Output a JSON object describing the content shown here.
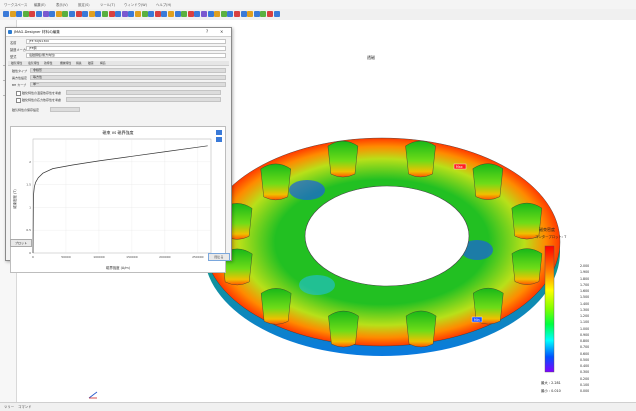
{
  "app": {
    "title_parts": [
      "ワークスペース",
      "編集(E)",
      "表示(V)",
      "設定(S)",
      "ツール(T)",
      "ウィンドウ(W)",
      "ヘルプ(H)"
    ]
  },
  "status": {
    "left_tab": "ツリー",
    "right_tab": "コマンド"
  },
  "dialog": {
    "title": "JMAG-Designer 材料の編集",
    "close": "×",
    "help": "?",
    "fields": [
      {
        "label": "名前",
        "value": "JFE 50JN1300"
      },
      {
        "label": "製造メーカー",
        "value": "JFE鋼"
      },
      {
        "label": "型式",
        "value": "電磁鋼板(無方向性)"
      }
    ],
    "tabs": [
      "磁気特性",
      "電気特性",
      "熱特性",
      "機械特性",
      "損失",
      "磁歪",
      "構造"
    ],
    "rows": [
      {
        "label": "磁性タイプ",
        "value": "非線形"
      },
      {
        "label": "異方性設定",
        "value": "等方性"
      },
      {
        "label": "BH カーブ",
        "value": "単一"
      }
    ],
    "checks": [
      "磁化特性の温度依存性を考慮",
      "磁化特性の応力依存性を考慮"
    ],
    "extra_label": "磁気特性の保存設定",
    "chart_title": "磁束 vs 磁界強度",
    "chart_ylabel": "磁束密度 (T)",
    "chart_xlabel": "磁界強度 (A/m)",
    "bottom_left_btn": "プロット",
    "ok_btn": "閉じる"
  },
  "viewport": {
    "plot_title": "透磁",
    "legend_title_1": "磁束密度",
    "legend_title_2": "コンタープロット: T",
    "legend_values": [
      "2.000",
      "1.900",
      "1.800",
      "1.700",
      "1.600",
      "1.500",
      "1.400",
      "1.300",
      "1.200",
      "1.100",
      "1.000",
      "0.900",
      "0.800",
      "0.700",
      "0.600",
      "0.500",
      "0.400",
      "0.300",
      "0.200",
      "0.100",
      "0.000"
    ],
    "max_label": "最大 : 2.281",
    "min_label": "最小 : 0.010",
    "callout_max": "Max",
    "callout_min": "Min"
  },
  "chart_data": {
    "type": "line",
    "title": "磁束 vs 磁界強度",
    "xlabel": "磁界強度 (A/m)",
    "ylabel": "磁束密度 (T)",
    "xlim": [
      0,
      270000
    ],
    "ylim": [
      0,
      2.5
    ],
    "x_ticks": [
      "0",
      "50000",
      "100000",
      "150000",
      "200000",
      "250000"
    ],
    "y_ticks": [
      "0",
      "0.5",
      "1",
      "1.5",
      "2"
    ],
    "series": [
      {
        "x": [
          0,
          500,
          1000,
          2000,
          4000,
          8000,
          15000,
          30000,
          60000,
          100000,
          150000,
          200000,
          250000,
          265000
        ],
        "y": [
          0,
          1.05,
          1.3,
          1.45,
          1.55,
          1.65,
          1.75,
          1.85,
          1.93,
          2.02,
          2.12,
          2.22,
          2.32,
          2.35
        ]
      }
    ]
  }
}
